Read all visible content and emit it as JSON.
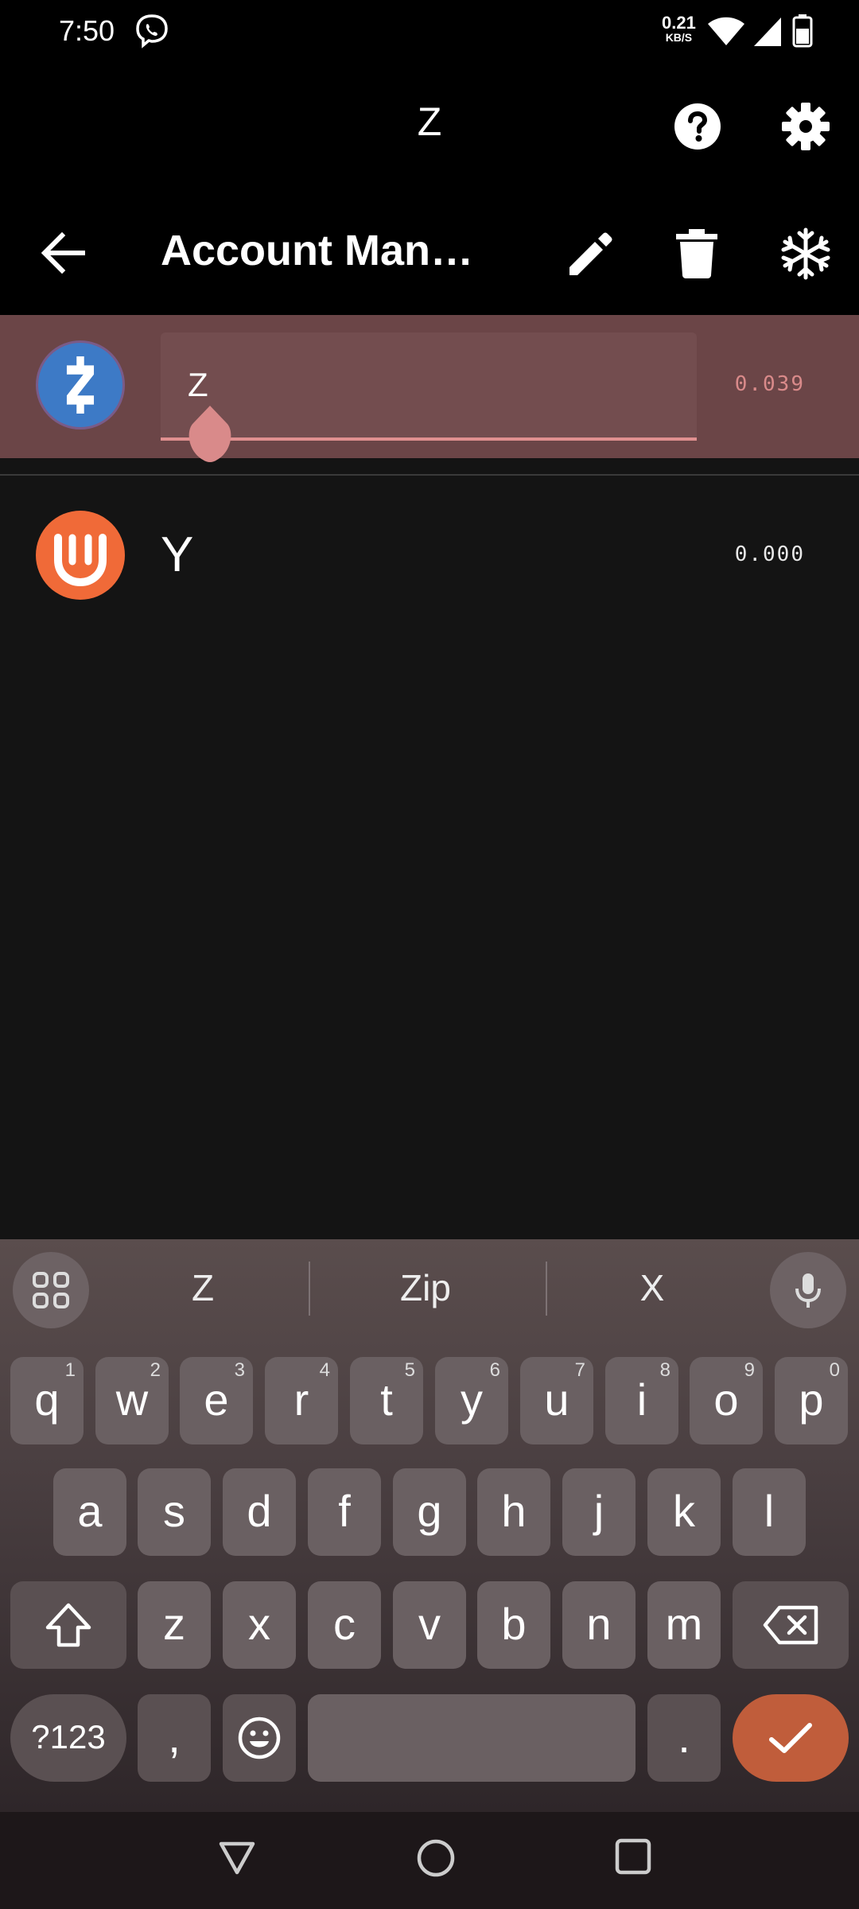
{
  "status_bar": {
    "time": "7:50",
    "net_rate": "0.21",
    "net_unit": "KB/S"
  },
  "app_bar": {
    "title": "Z",
    "help_icon": "help-circle-icon",
    "settings_icon": "gear-icon"
  },
  "toolbar": {
    "title": "Account Management",
    "back_icon": "arrow-left-icon",
    "edit_icon": "pencil-icon",
    "delete_icon": "trash-icon",
    "freeze_icon": "snowflake-icon"
  },
  "accounts": [
    {
      "name": "Z",
      "balance": "0.039",
      "icon": "zcash-logo",
      "color": "#3d7ac6",
      "editing": true
    },
    {
      "name": "Y",
      "balance": "0.000",
      "icon": "ycash-logo",
      "color": "#f06a38",
      "editing": false
    }
  ],
  "keyboard": {
    "suggestions": [
      "Z",
      "Zip",
      "X"
    ],
    "row1": [
      {
        "k": "q",
        "n": "1"
      },
      {
        "k": "w",
        "n": "2"
      },
      {
        "k": "e",
        "n": "3"
      },
      {
        "k": "r",
        "n": "4"
      },
      {
        "k": "t",
        "n": "5"
      },
      {
        "k": "y",
        "n": "6"
      },
      {
        "k": "u",
        "n": "7"
      },
      {
        "k": "i",
        "n": "8"
      },
      {
        "k": "o",
        "n": "9"
      },
      {
        "k": "p",
        "n": "0"
      }
    ],
    "row2": [
      "a",
      "s",
      "d",
      "f",
      "g",
      "h",
      "j",
      "k",
      "l"
    ],
    "row3": [
      "z",
      "x",
      "c",
      "v",
      "b",
      "n",
      "m"
    ],
    "symbols_label": "?123",
    "comma": ",",
    "period": ".",
    "accent_color": "#c05d3b"
  }
}
